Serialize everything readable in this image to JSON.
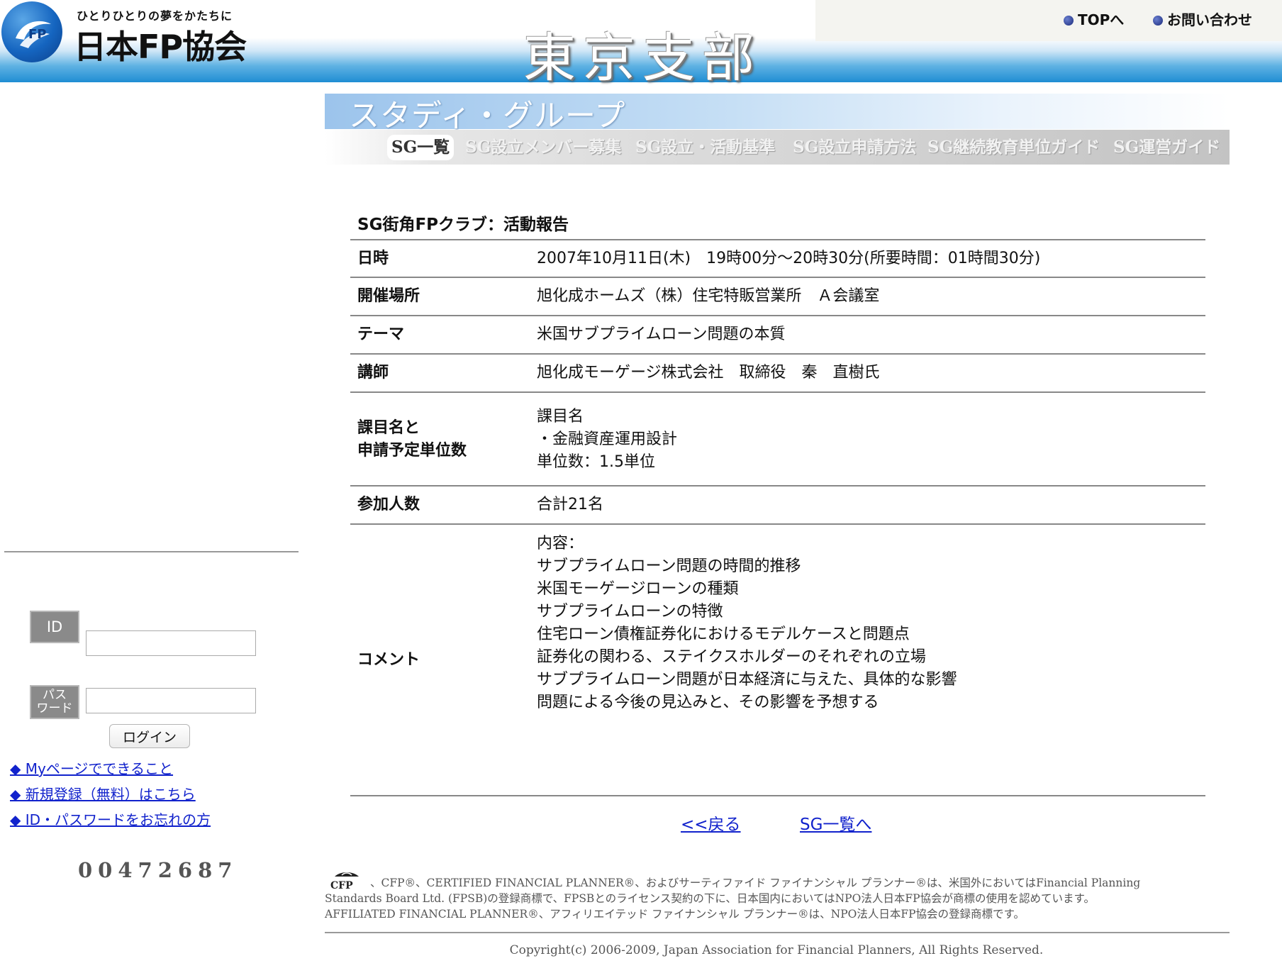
{
  "header": {
    "tagline": "ひとりひとりの夢をかたちに",
    "org_name": "日本FP協会",
    "branch_title": "東京支部",
    "nav": {
      "top": "TOPへ",
      "contact": "お問い合わせ"
    }
  },
  "sg_banner": {
    "title": "スタディ・グループ",
    "tabs": [
      "SG一覧",
      "SG設立メンバー募集",
      "SG設立・活動基準",
      "SG設立申請方法",
      "SG継続教育単位ガイド",
      "SG運営ガイド"
    ],
    "active_tab": "SG一覧"
  },
  "report": {
    "title": "SG街角FPクラブ：活動報告",
    "rows": {
      "datetime": {
        "label": "日時",
        "value": "2007年10月11日(木)　19時00分～20時30分(所要時間：01時間30分)"
      },
      "venue": {
        "label": "開催場所",
        "value": "旭化成ホームズ（株）住宅特販営業所　Ａ会議室"
      },
      "theme": {
        "label": "テーマ",
        "value": "米国サブプライムローン問題の本質"
      },
      "lecturer": {
        "label": "講師",
        "value": "旭化成モーゲージ株式会社　取締役　秦　直樹氏"
      },
      "subject": {
        "label_line1": "課目名と",
        "label_line2": "申請予定単位数",
        "lines": [
          "課目名",
          "・金融資産運用設計",
          "単位数：1.5単位"
        ]
      },
      "attendees": {
        "label": "参加人数",
        "value": "合計21名"
      },
      "comment": {
        "label": "コメント",
        "lines": [
          "内容：",
          "サブプライムローン問題の時間的推移",
          "米国モーゲージローンの種類",
          "サブプライムローンの特徴",
          "住宅ローン債権証券化におけるモデルケースと問題点",
          "証券化の関わる、ステイクスホルダーのそれぞれの立場",
          "サブプライムローン問題が日本経済に与えた、具体的な影響",
          "問題による今後の見込みと、その影響を予想する"
        ]
      }
    }
  },
  "bottom_nav": {
    "back": "<<戻る",
    "sg_list": "SG一覧へ"
  },
  "sidebar": {
    "id_label": "ID",
    "password_label_line1": "パス",
    "password_label_line2": "ワード",
    "login_button": "ログイン",
    "links": [
      "◆ Myページでできること",
      "◆ 新規登録（無料）はこちら",
      "◆ ID・パスワードをお忘れの方"
    ],
    "counter": "00472687"
  },
  "footer": {
    "cfp_logo_text": "CFP",
    "disclaimer_line1": "、CFP®、CERTIFIED FINANCIAL PLANNER®、およびサーティファイド ファイナンシャル プランナー®は、米国外においてはFinancial Planning",
    "disclaimer_line2": "Standards Board Ltd. (FPSB)の登録商標で、FPSBとのライセンス契約の下に、日本国内においてはNPO法人日本FP協会が商標の使用を認めています。",
    "disclaimer_line3": "AFFILIATED FINANCIAL PLANNER®、アフィリエイテッド ファイナンシャル プランナー®は、NPO法人日本FP協会の登録商標です。",
    "copyright": "Copyright(c) 2006-2009, Japan Association for Financial Planners, All Rights Reserved."
  },
  "colors": {
    "header_blue": "#1f8dd3",
    "link_blue": "#1122cc",
    "sg_title_bar": "#9cc4ec"
  }
}
